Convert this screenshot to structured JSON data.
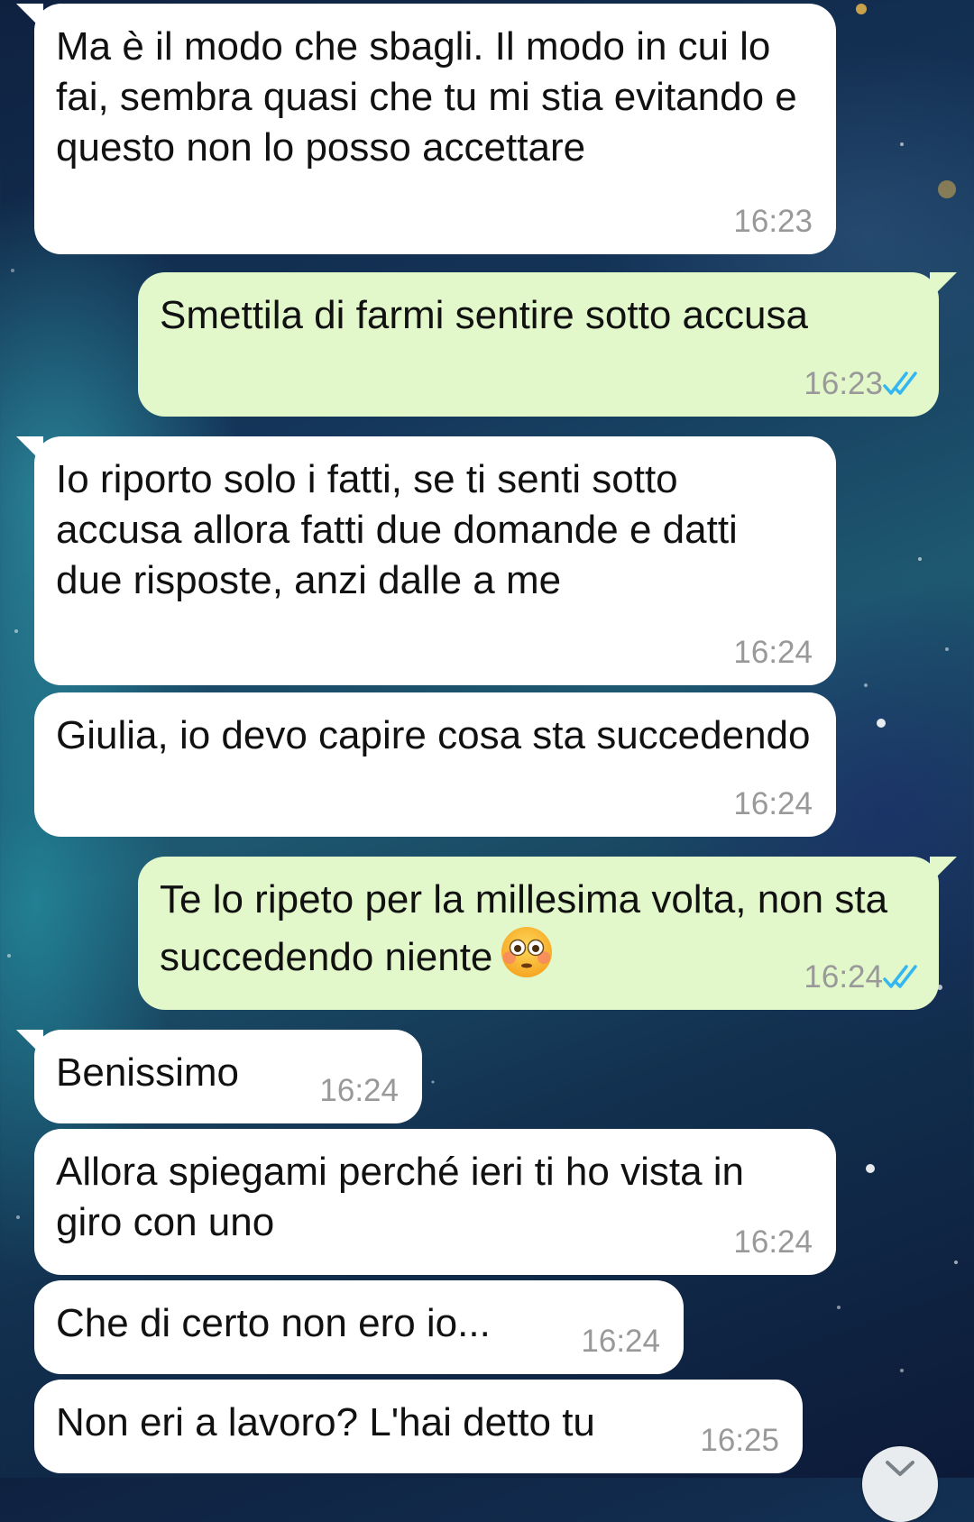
{
  "messages": [
    {
      "direction": "incoming",
      "text": "Ma è il modo che sbagli. Il modo in cui lo fai, sembra quasi che tu mi stia evitando e questo non lo posso accettare",
      "time": "16:23"
    },
    {
      "direction": "outgoing",
      "text": "Smettila di farmi sentire sotto accusa",
      "time": "16:23",
      "status": "read"
    },
    {
      "direction": "incoming",
      "text": "Io riporto solo i fatti, se ti senti sotto accusa allora fatti due domande e datti due risposte, anzi dalle a me",
      "time": "16:24"
    },
    {
      "direction": "incoming",
      "text": "Giulia, io devo capire cosa sta succedendo",
      "time": "16:24"
    },
    {
      "direction": "outgoing",
      "text": "Te lo ripeto per la millesima volta, non sta succedendo niente",
      "emoji": "flushed-face",
      "time": "16:24",
      "status": "read"
    },
    {
      "direction": "incoming",
      "text": "Benissimo",
      "time": "16:24"
    },
    {
      "direction": "incoming",
      "text": "Allora spiegami perché ieri ti ho vista in giro con uno",
      "time": "16:24"
    },
    {
      "direction": "incoming",
      "text": "Che di certo non ero io...",
      "time": "16:24"
    },
    {
      "direction": "incoming",
      "text": "Non eri a lavoro? L'hai detto tu",
      "time": "16:25"
    }
  ],
  "colors": {
    "incoming_bubble": "#ffffff",
    "outgoing_bubble": "#e2f8ca",
    "read_ticks": "#34b7f1",
    "timestamp": "#999999"
  },
  "icons": {
    "read_receipt": "double-check-icon",
    "scroll_down": "chevron-down-icon"
  }
}
